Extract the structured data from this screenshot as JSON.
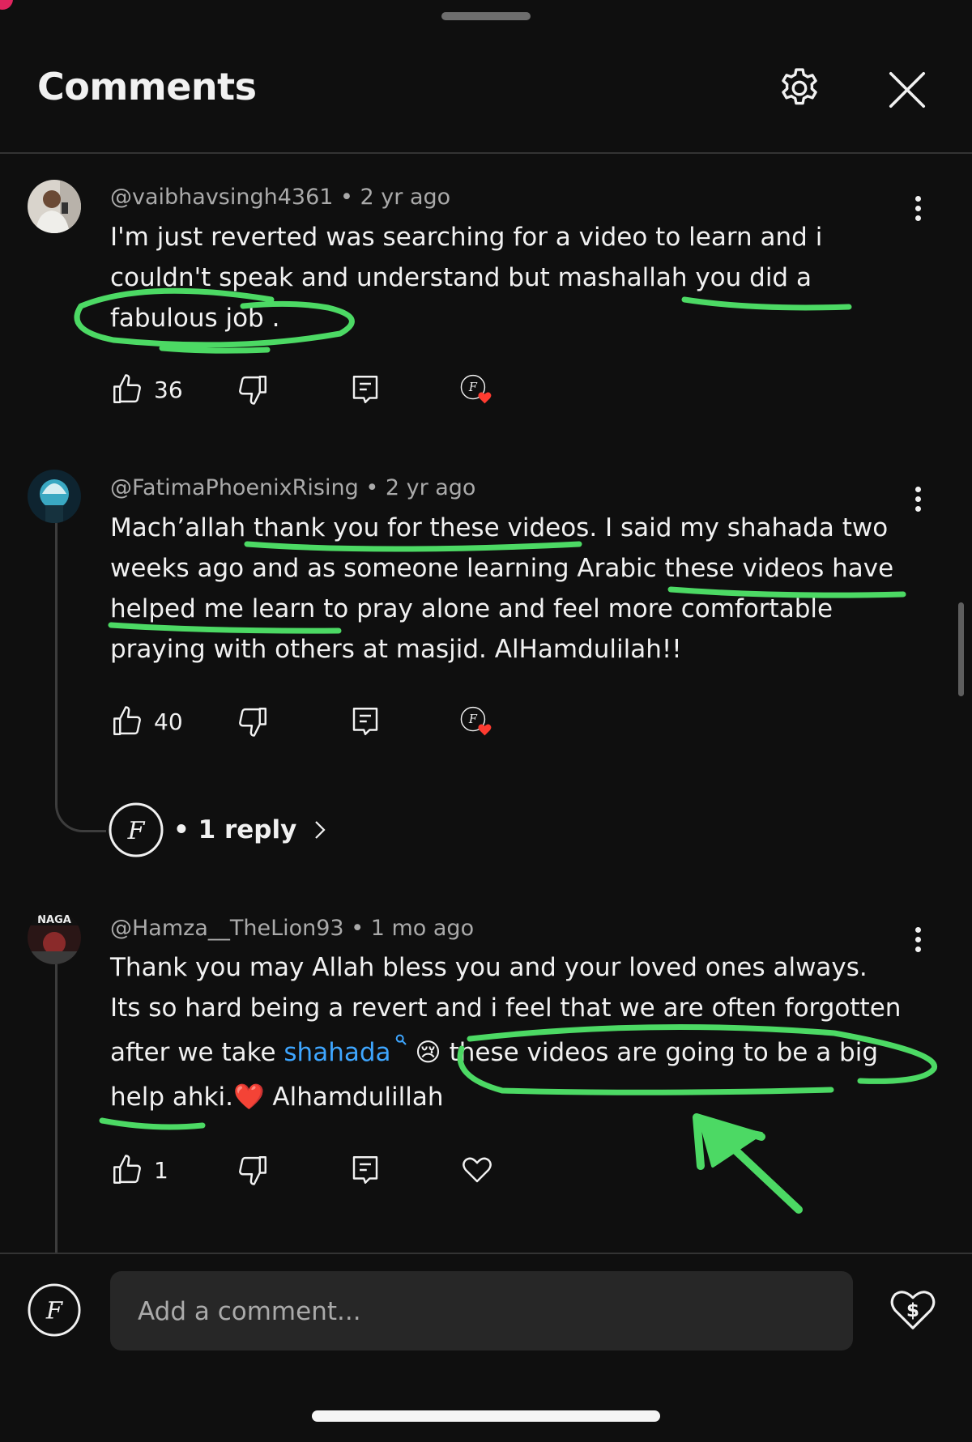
{
  "header": {
    "title": "Comments",
    "settings_icon": "gear-icon",
    "close_icon": "close-icon"
  },
  "comments": [
    {
      "handle": "@vaibhavsingh4361",
      "time": "2 yr ago",
      "lines": [
        "I'm just reverted was searching for a video to learn and i",
        "couldn't speak and understand but mashallah you did a",
        "fabulous job ."
      ],
      "likes": "36",
      "creator_hearted": true
    },
    {
      "handle": "@FatimaPhoenixRising",
      "time": "2 yr ago",
      "lines": [
        "Mach’allah thank you for these videos. I said my shahada two",
        "weeks ago and as someone learning Arabic these videos have",
        "helped me learn to pray alone and feel more comfortable",
        "praying with others at masjid. AlHamdulilah!!"
      ],
      "likes": "40",
      "creator_hearted": true,
      "replies_label": "1 reply"
    },
    {
      "handle": "@Hamza__TheLion93",
      "time": "1 mo ago",
      "lines": [
        "Thank you may Allah bless you and your loved ones always.",
        "Its so hard being a revert and i feel that we are often forgotten"
      ],
      "line3_before": "after we take ",
      "line3_link": "shahada",
      "line3_emoji": "😢",
      "line3_after": "these videos are going to be a big",
      "line4_before": "help ahki.",
      "line4_emoji": "❤️",
      "line4_after": " Alhamdulillah",
      "likes": "1",
      "creator_hearted": false
    }
  ],
  "composer": {
    "placeholder": "Add a comment..."
  },
  "colors": {
    "background": "#0f0f0f",
    "text": "#f1f1f1",
    "meta": "#aaaaaa",
    "link": "#3ea6ff",
    "annotation_green": "#4cd964",
    "heart_red": "#ff3b30"
  }
}
